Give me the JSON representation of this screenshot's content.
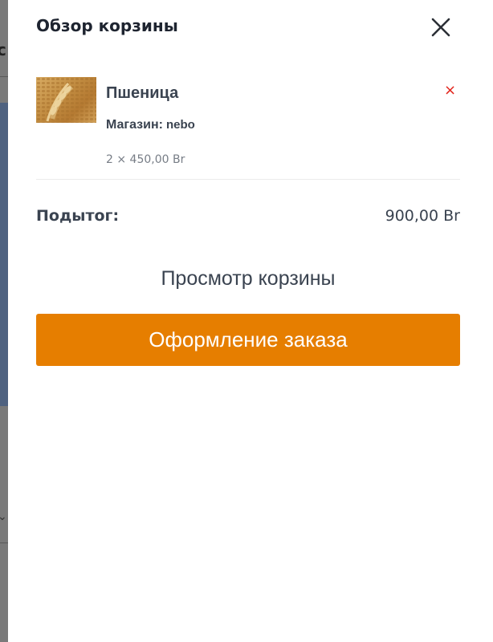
{
  "drawer": {
    "title": "Обзор корзины",
    "close_icon": "close-icon"
  },
  "cart": {
    "items": [
      {
        "name": "Пшеница",
        "shop_label": "Магазин:",
        "shop_value": "nebo",
        "quantity_price": "2 × 450,00 Br",
        "thumbnail_icon": "wheat-image",
        "remove_glyph": "×"
      }
    ],
    "subtotal_label": "Подытог:",
    "subtotal_value": "900,00 Br"
  },
  "actions": {
    "view_cart_label": "Просмотр корзины",
    "checkout_label": "Оформление заказа"
  },
  "colors": {
    "accent": "#e67e00",
    "remove": "#e2231a",
    "text": "#3a4350"
  }
}
